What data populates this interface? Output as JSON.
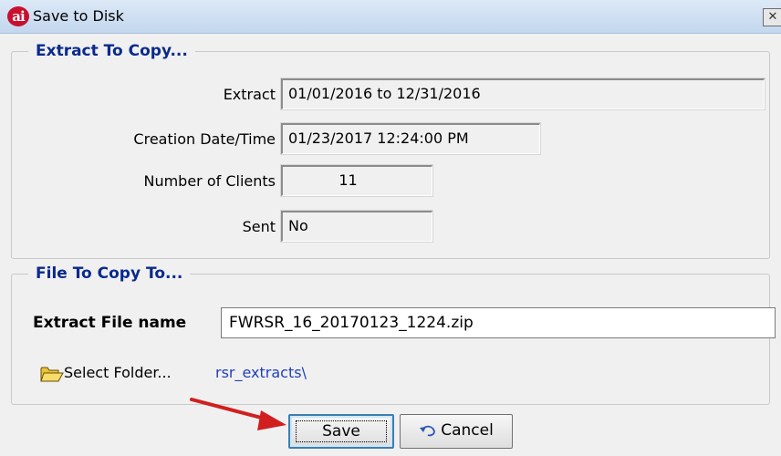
{
  "window": {
    "title": "Save to Disk",
    "icon_text": "ai",
    "close_glyph": "✕"
  },
  "extract_group": {
    "legend": "Extract To Copy...",
    "fields": {
      "extract": {
        "label": "Extract",
        "value": "01/01/2016 to 12/31/2016"
      },
      "creation": {
        "label": "Creation Date/Time",
        "value": "01/23/2017 12:24:00 PM"
      },
      "clients": {
        "label": "Number of Clients",
        "value": "11"
      },
      "sent": {
        "label": "Sent",
        "value": "No"
      }
    }
  },
  "file_group": {
    "legend": "File To Copy To...",
    "filename_label": "Extract File name",
    "filename_value": "FWRSR_16_20170123_1224.zip",
    "select_folder_label": "Select Folder...",
    "folder_path": "rsr_extracts\\"
  },
  "buttons": {
    "save": "Save",
    "cancel": "Cancel"
  },
  "icons": {
    "app": "app-logo-icon",
    "folder": "open-folder-icon",
    "undo": "undo-arrow-icon",
    "annotation": "red-arrow-pointer"
  },
  "colors": {
    "legend": "#0a2a8c",
    "folder_path": "#1f3fbf",
    "app_icon": "#c8102e",
    "annotation_arrow": "#d11f1f"
  }
}
